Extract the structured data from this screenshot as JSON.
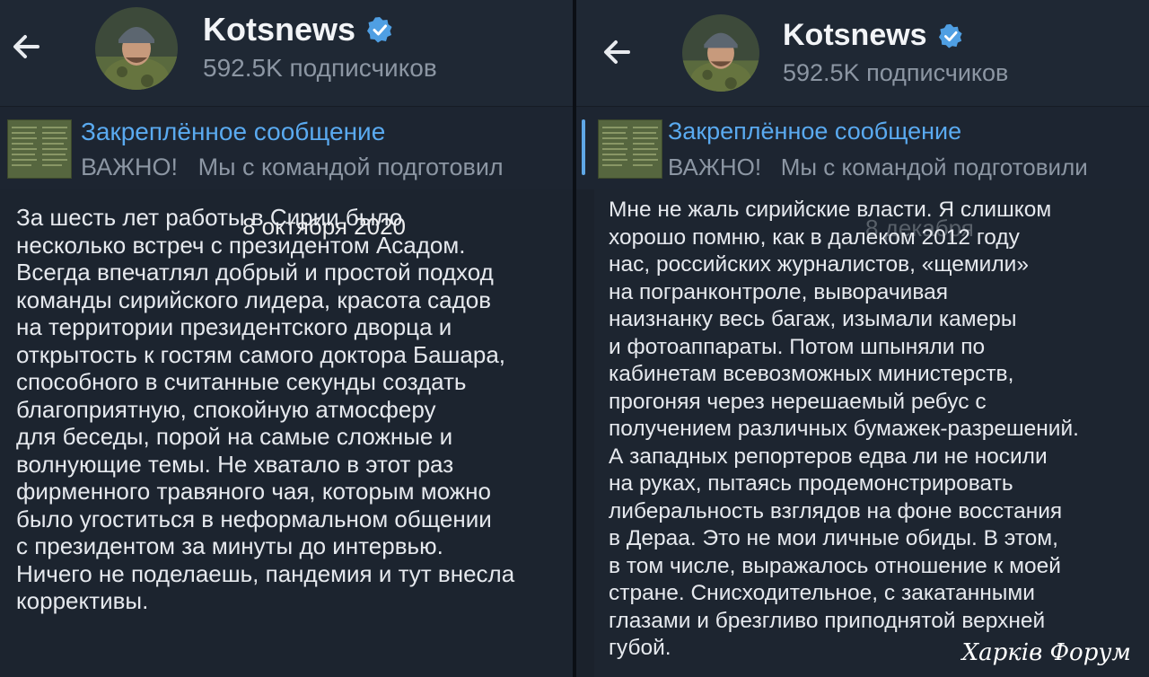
{
  "channel": {
    "name": "Kotsnews",
    "subscribers": "592.5K подписчиков"
  },
  "pinned": {
    "title": "Закреплённое сообщение",
    "prefix": "ВАЖНО!",
    "preview_left": "Мы с командой подготовил",
    "preview_right": "Мы с командой подготовили"
  },
  "left_post": {
    "date": "8 октября 2020",
    "lines": [
      "За шесть лет работы в Сирии было",
      "несколько встреч с президентом Асадом.",
      "Всегда впечатлял добрый и простой подход",
      "команды сирийского лидера, красота садов",
      "на территории президентского дворца и",
      "открытость к гостям самого доктора Башара,",
      "способного в считанные секунды создать",
      "благоприятную, спокойную атмосферу",
      "для беседы, порой на самые сложные и",
      "волнующие темы. Не хватало в этот раз",
      "фирменного травяного чая, которым можно",
      "было угоститься в неформальном общении",
      "с президентом за минуты до интервью.",
      "Ничего не поделаешь, пандемия и тут внесла",
      "коррективы."
    ]
  },
  "right_post": {
    "date": "8 декабря",
    "lines": [
      "Мне не жаль сирийские власти. Я слишком",
      "хорошо помню, как в далеком 2012 году",
      "нас, российских журналистов, «щемили»",
      "на погранконтроле, выворачивая",
      "наизнанку весь багаж, изымали камеры",
      "и фотоаппараты. Потом шпыняли по",
      "кабинетам всевозможных министерств,",
      "прогоняя через нерешаемый ребус с",
      "получением различных бумажек-разрешений.",
      "А западных репортеров едва ли не носили",
      "на руках, пытаясь продемонстрировать",
      "либеральность взглядов на фоне восстания",
      "в Дераа. Это не мои личные обиды. В этом,",
      "в том числе, выражалось отношение к моей",
      "стране. Снисходительное, с закатанными",
      "глазами и брезгливо приподнятой верхней",
      "губой."
    ]
  },
  "watermark": "Харків Форум",
  "icons": {
    "back": "back-arrow-icon",
    "verified": "verified-badge-icon",
    "avatar": "channel-avatar"
  },
  "colors": {
    "accent": "#5aaaf0",
    "background": "#1f2733"
  }
}
